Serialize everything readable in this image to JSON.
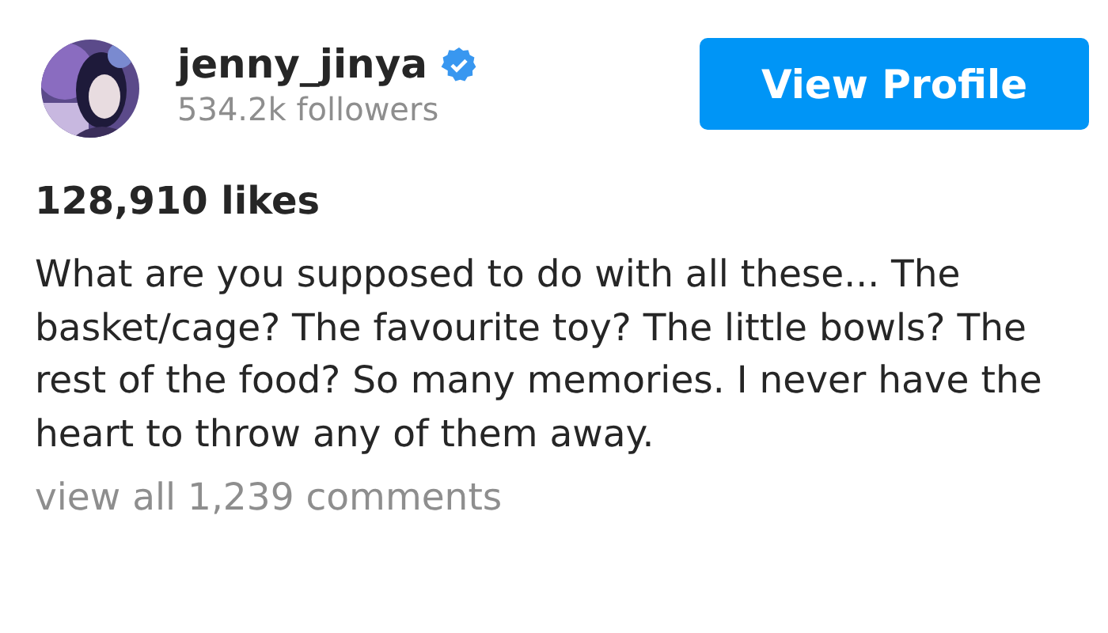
{
  "profile": {
    "username": "jenny_jinya",
    "verified": true,
    "followers": "534.2k followers"
  },
  "view_profile_button": "View Profile",
  "likes": "128,910 likes",
  "caption": "What are you supposed to do with all these... The basket/cage? The favourite toy? The little bowls? The rest of the food? So many memories. I never have the heart to throw any of them away.",
  "comments_link": "view all 1,239 comments"
}
